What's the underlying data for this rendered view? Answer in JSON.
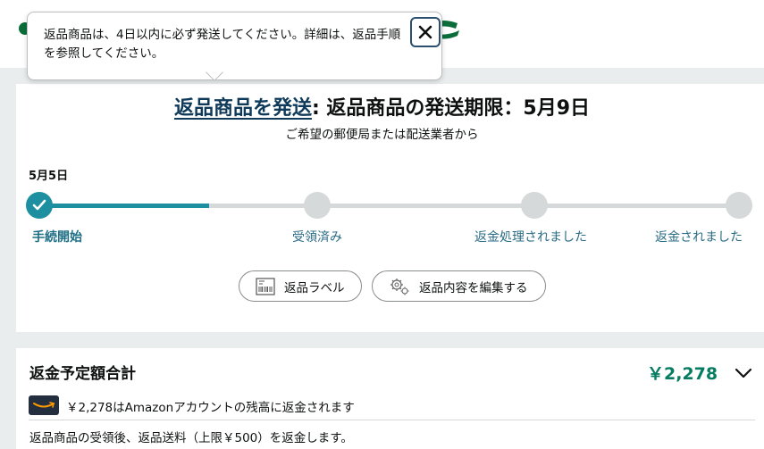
{
  "tooltip": {
    "text": "返品商品は、4日以内に必ず発送してください。詳細は、返品手順を参照してください。",
    "close_icon": "close-icon"
  },
  "header": {
    "title_link": "返品商品を発送",
    "title_rest": ": 返品商品の発送期限：5月9日",
    "subtitle": "ご希望の郵便局または配送業者から"
  },
  "progress": {
    "date": "5月5日",
    "steps": [
      {
        "label": "手続開始",
        "done": true
      },
      {
        "label": "受領済み",
        "done": false
      },
      {
        "label": "返金処理されました",
        "done": false
      },
      {
        "label": "返金されました",
        "done": false
      }
    ],
    "progress_fraction": 0.25
  },
  "actions": {
    "label_button": "返品ラベル",
    "edit_button": "返品内容を編集する"
  },
  "refund": {
    "title": "返金予定額合計",
    "amount": "￥2,278",
    "line1": "￥2,278はAmazonアカウントの残高に返金されます",
    "line2": "返品商品の受領後、返品送料（上限￥500）を返金します。"
  },
  "colors": {
    "accent": "#1d8fa0",
    "amount": "#067d62",
    "link": "#0f3a5a"
  }
}
